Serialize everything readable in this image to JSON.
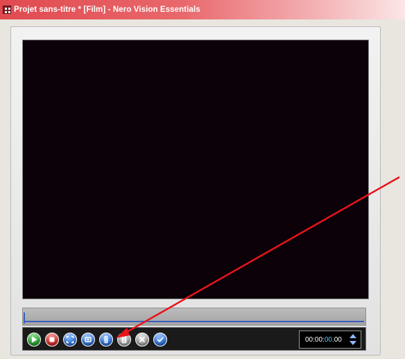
{
  "window": {
    "title": "Projet sans-titre * [Film] - Nero Vision Essentials"
  },
  "player": {
    "buttons": [
      {
        "name": "play-button",
        "icon": "play-icon",
        "color": "#1c9a2a"
      },
      {
        "name": "stop-button",
        "icon": "stop-icon",
        "color": "#d3201c"
      },
      {
        "name": "fullscreen-button",
        "icon": "fullscreen-icon",
        "color": "#2267d6"
      },
      {
        "name": "snapshot-button",
        "icon": "snapshot-icon",
        "color": "#2267d6"
      },
      {
        "name": "split-button",
        "icon": "split-icon",
        "color": "#2267d6"
      },
      {
        "name": "trim-button",
        "icon": "trim-icon",
        "color": "#9a9a9a"
      },
      {
        "name": "delete-button",
        "icon": "x-icon",
        "color": "#9a9a9a"
      },
      {
        "name": "confirm-button",
        "icon": "checkmark-icon",
        "color": "#2267d6"
      }
    ],
    "timecode": {
      "prefix": "00:00:",
      "highlight": "00",
      "suffix": ".00"
    }
  },
  "colors": {
    "titlebar": "#e04a4f",
    "video_background": "#0c0109",
    "timeline_track": "#3a5fc2",
    "annotation_arrow": "#e8141a",
    "timecode_highlight": "#5fc8ff"
  }
}
